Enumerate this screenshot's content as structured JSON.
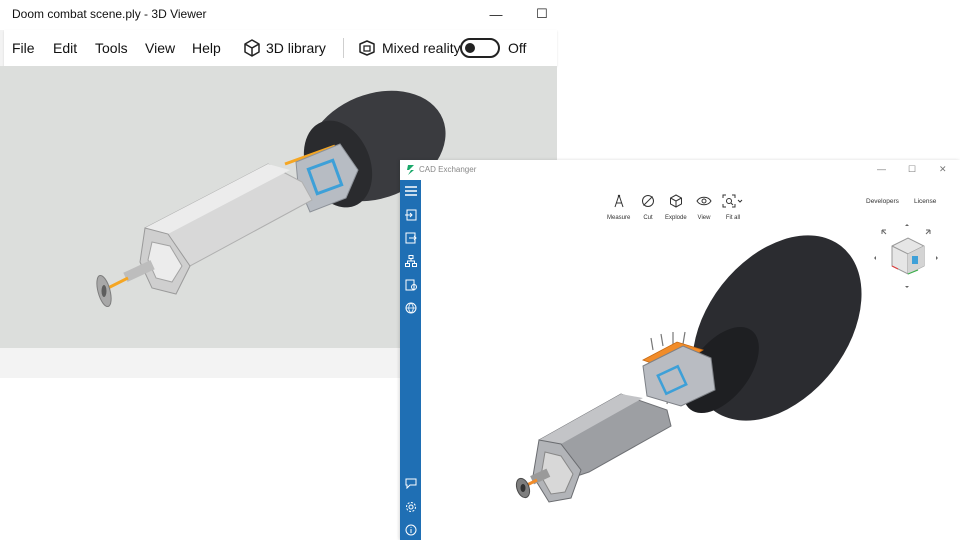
{
  "viewer3d": {
    "window_title": "Doom combat scene.ply - 3D Viewer",
    "minimize_glyph": "—",
    "maximize_glyph": "☐",
    "menu": {
      "file": "File",
      "edit": "Edit",
      "tools": "Tools",
      "view": "View",
      "help": "Help",
      "library": "3D library",
      "mixed_reality": "Mixed reality",
      "mixed_reality_state": "Off"
    },
    "toggle_on": false
  },
  "cad_exchanger": {
    "window_title": "CAD Exchanger",
    "window_buttons": {
      "minimize": "—",
      "maximize": "☐",
      "close": "✕"
    },
    "toolbar": {
      "measure": "Measure",
      "cut": "Cut",
      "explode": "Explode",
      "view": "View",
      "fit_all": "Fit all"
    },
    "links": {
      "developers": "Developers",
      "license": "License"
    },
    "sidebar_color": "#1f6fb4"
  },
  "colors": {
    "model_body": "#c9c9c9",
    "model_dark": "#2e2f33",
    "accent_orange": "#f39a25"
  }
}
